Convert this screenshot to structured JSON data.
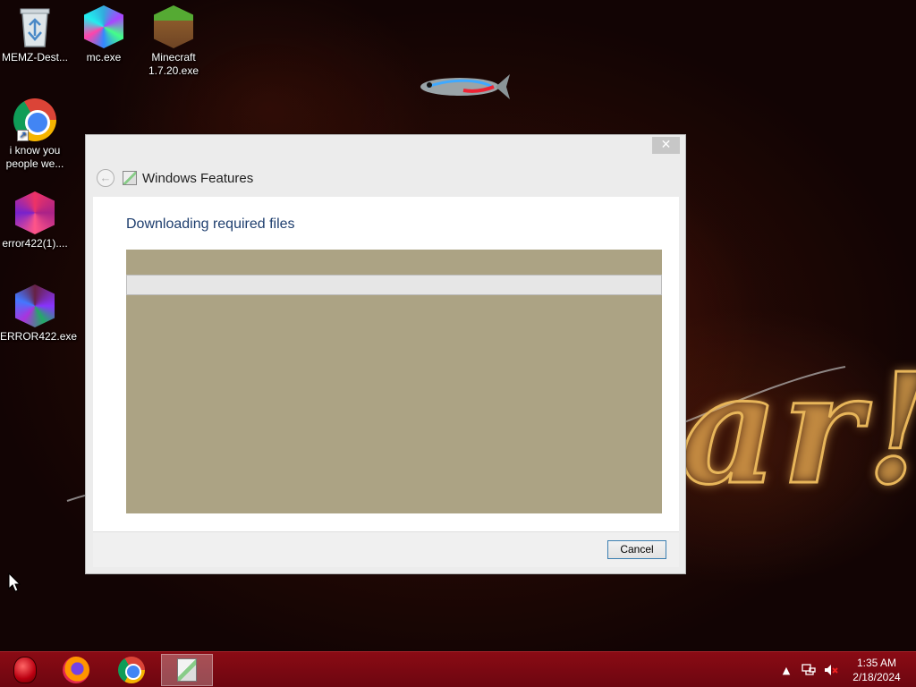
{
  "desktop": {
    "icons": [
      {
        "label": "MEMZ-Dest..."
      },
      {
        "label": "mc.exe"
      },
      {
        "label": "Minecraft 1.7.20.exe"
      },
      {
        "label": "i know you people we..."
      },
      {
        "label": "error422(1)...."
      },
      {
        "label": "ERROR422.exe"
      }
    ]
  },
  "window": {
    "title": "Windows Features",
    "close_glyph": "✕",
    "back_glyph": "←",
    "heading": "Downloading required files",
    "progress_fraction": 0,
    "cancel_label": "Cancel"
  },
  "taskbar": {
    "items": [
      {
        "icon": "start-orb-icon"
      },
      {
        "icon": "firefox-icon"
      },
      {
        "icon": "chrome-icon"
      },
      {
        "icon": "windows-features-icon",
        "active": true
      }
    ],
    "tray": {
      "show_hidden_glyph": "▲",
      "time": "1:35 AM",
      "date": "2/18/2024"
    }
  },
  "colors": {
    "taskbar": "#7a0811",
    "heading": "#1e3e6e",
    "khaki": "#aca384",
    "button_border": "#3c7fb1"
  }
}
